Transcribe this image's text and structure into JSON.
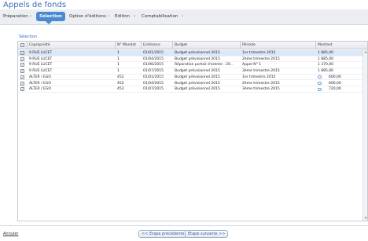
{
  "window": {
    "title": "Appels de fonds"
  },
  "wizard": {
    "steps": [
      {
        "label": "Préparation"
      },
      {
        "label": "Sélection"
      },
      {
        "label": "Option d'éditions"
      },
      {
        "label": "Edition"
      },
      {
        "label": "Comptabilisation"
      }
    ],
    "separator": "›"
  },
  "section": {
    "label": "Sélection"
  },
  "table": {
    "headers": [
      "Copropriété",
      "N° Mandat",
      "Echéance",
      "Budget",
      "Période",
      "Montant"
    ],
    "rows": [
      {
        "checked": "✓",
        "copro": "9 RUE LUCET",
        "mandat": "1",
        "echeance": "01/01/2015",
        "budget": "Budget prévisionnel 2015",
        "periode": "1er trimestre 2015",
        "montant": "1 885,00",
        "comment": false
      },
      {
        "checked": "✓",
        "copro": "9 RUE LUCET",
        "mandat": "1",
        "echeance": "01/04/2015",
        "budget": "Budget prévisionnel 2015",
        "periode": "2ème trimestre 2015",
        "montant": "1 885,00",
        "comment": false
      },
      {
        "checked": "✓",
        "copro": "9 RUE LUCET",
        "mandat": "1",
        "echeance": "01/06/2015",
        "budget": "Réparation portail d'entrée - 20...",
        "periode": "Appel N° 1",
        "montant": "1 370,00",
        "comment": false
      },
      {
        "checked": "✓",
        "copro": "9 RUE LUCET",
        "mandat": "1",
        "echeance": "01/07/2015",
        "budget": "Budget prévisionnel 2015",
        "periode": "3ème trimestre 2015",
        "montant": "1 885,00",
        "comment": false
      },
      {
        "checked": "✓",
        "copro": "ALTER / EGO",
        "mandat": "452",
        "echeance": "01/01/2015",
        "budget": "Budget prévisionnel 2015",
        "periode": "1er trimestre 2015",
        "montant": "600,00",
        "comment": true
      },
      {
        "checked": "✓",
        "copro": "ALTER / EGO",
        "mandat": "452",
        "echeance": "01/04/2015",
        "budget": "Budget prévisionnel 2015",
        "periode": "2ème trimestre 2015",
        "montant": "600,00",
        "comment": true
      },
      {
        "checked": "✓",
        "copro": "ALTER / EGO",
        "mandat": "452",
        "echeance": "01/07/2015",
        "budget": "Budget prévisionnel 2015",
        "periode": "3ème trimestre 2015",
        "montant": "720,00",
        "comment": true
      }
    ],
    "header_checkbox": "✓"
  },
  "footer": {
    "cancel_label": "Annuler",
    "prev_label": "<< Etape précédente",
    "next_label": "Etape suivante >>"
  },
  "colors": {
    "accent": "#4a8ad1",
    "title": "#3a6fb5",
    "selected_row": "#dbe8f7"
  }
}
